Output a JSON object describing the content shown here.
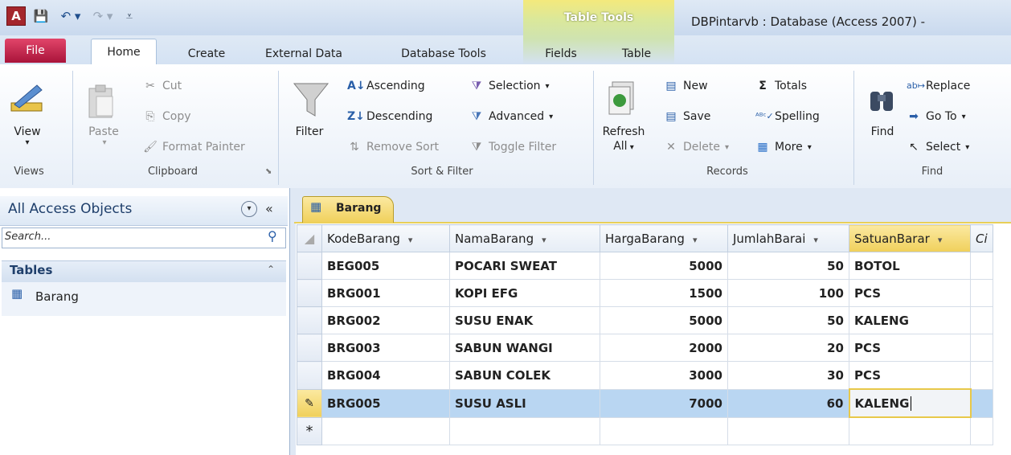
{
  "window": {
    "title": "DBPintarvb : Database (Access 2007) -",
    "context_group": "Table Tools"
  },
  "tabs": [
    "File",
    "Home",
    "Create",
    "External Data",
    "Database Tools",
    "Fields",
    "Table"
  ],
  "ribbon": {
    "views": {
      "view_label": "View",
      "group": "Views"
    },
    "clipboard": {
      "paste": "Paste",
      "cut": "Cut",
      "copy": "Copy",
      "format_painter": "Format Painter",
      "group": "Clipboard"
    },
    "sort_filter": {
      "filter": "Filter",
      "ascending": "Ascending",
      "descending": "Descending",
      "remove_sort": "Remove Sort",
      "selection": "Selection",
      "advanced": "Advanced",
      "toggle_filter": "Toggle Filter",
      "group": "Sort & Filter"
    },
    "records": {
      "refresh": "Refresh",
      "refresh_all": "All",
      "new": "New",
      "save": "Save",
      "delete": "Delete",
      "totals": "Totals",
      "spelling": "Spelling",
      "more": "More",
      "group": "Records"
    },
    "find": {
      "find": "Find",
      "replace": "Replace",
      "goto": "Go To",
      "select": "Select",
      "group": "Find"
    }
  },
  "nav": {
    "title": "All Access Objects",
    "search_placeholder": "Search...",
    "section": "Tables",
    "items": [
      "Barang"
    ]
  },
  "document": {
    "tab": "Barang"
  },
  "grid": {
    "columns": [
      "KodeBarang",
      "NamaBarang",
      "HargaBarang",
      "JumlahBarai",
      "SatuanBarar",
      "Ci"
    ],
    "rows": [
      [
        "BEG005",
        "POCARI SWEAT",
        "5000",
        "50",
        "BOTOL"
      ],
      [
        "BRG001",
        "KOPI EFG",
        "1500",
        "100",
        "PCS"
      ],
      [
        "BRG002",
        "SUSU ENAK",
        "5000",
        "50",
        "KALENG"
      ],
      [
        "BRG003",
        "SABUN WANGI",
        "2000",
        "20",
        "PCS"
      ],
      [
        "BRG004",
        "SABUN COLEK",
        "3000",
        "30",
        "PCS"
      ],
      [
        "BRG005",
        "SUSU ASLI",
        "7000",
        "60",
        "KALENG"
      ]
    ],
    "editing_row_index": 5,
    "new_row_marker": "*"
  },
  "colors": {
    "file_tab": "#c41e45",
    "table_tools": "#e8d24a",
    "selected_row": "#b9d6f2"
  }
}
